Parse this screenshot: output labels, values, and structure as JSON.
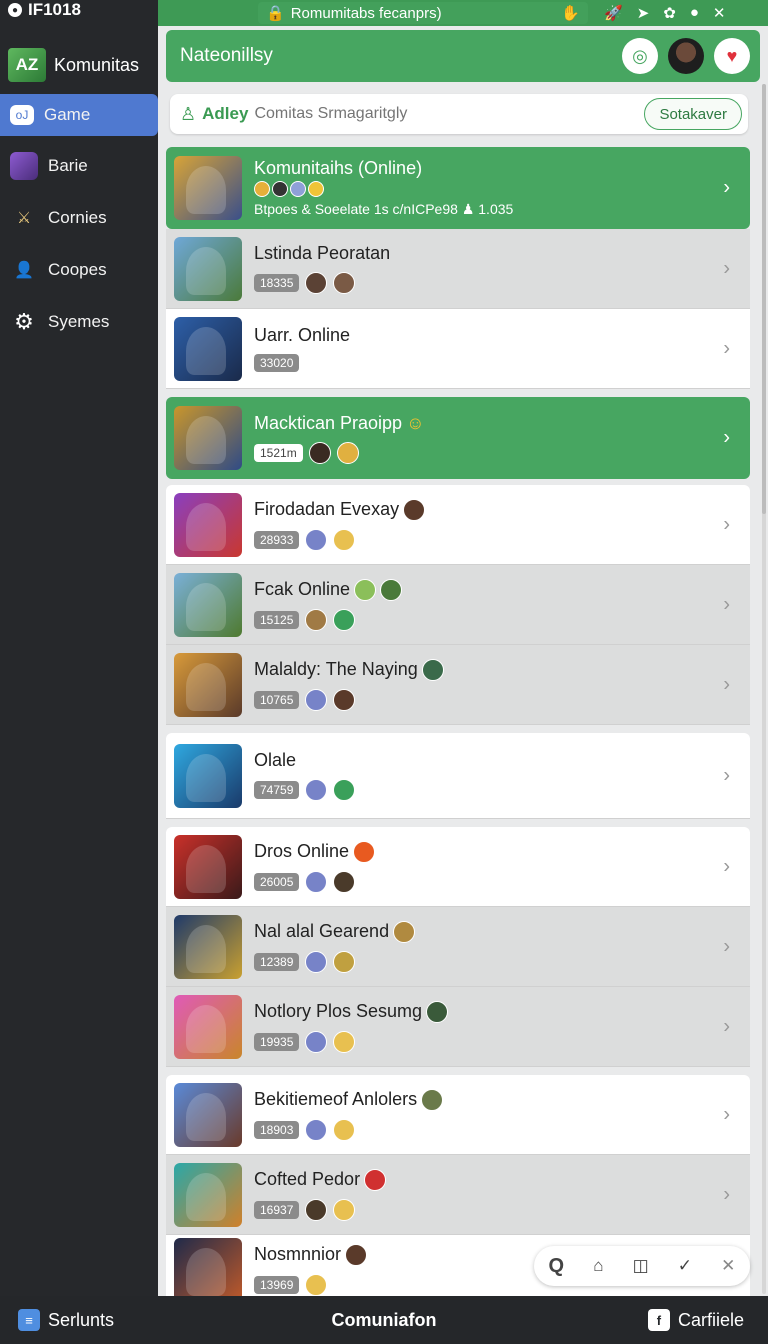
{
  "status": {
    "time": "IF1018"
  },
  "sidebar": {
    "brand_logo": "AZ",
    "brand_name": "Komunitas",
    "items": [
      {
        "label": "Game",
        "icon": "gamepad-icon",
        "active": true
      },
      {
        "label": "Barie",
        "icon": "character-icon"
      },
      {
        "label": "Cornies",
        "icon": "swords-icon"
      },
      {
        "label": "Coopes",
        "icon": "user-icon"
      },
      {
        "label": "Syemes",
        "icon": "gear-icon"
      }
    ]
  },
  "browser": {
    "url": "Romumitabs fecanprs)"
  },
  "header": {
    "title": "Nateonillsy"
  },
  "search": {
    "label": "Adley",
    "placeholder": "Comitas Srmagaritgly",
    "button": "Sotakaver"
  },
  "featured": {
    "title": "Komunitaihs (Online)",
    "subtitle": "Btpoes & Soeelate 1s c/nICPe98",
    "count": "1.035"
  },
  "games": [
    {
      "title": "Lstinda Peoratan",
      "badge": "18335",
      "style": "grey"
    },
    {
      "title": "Uarr. Online",
      "badge": "33020",
      "style": "white"
    },
    {
      "title": "Macktican Praoipp",
      "badge": "1521m",
      "style": "green"
    },
    {
      "title": "Firodadan Evexay",
      "badge": "28933",
      "style": "white"
    },
    {
      "title": "Fcak Online",
      "badge": "15125",
      "style": "grey"
    },
    {
      "title": "Malaldy: The Naying",
      "badge": "10765",
      "style": "grey"
    },
    {
      "title": "Olale",
      "badge": "74759",
      "style": "white"
    },
    {
      "title": "Dros Online",
      "badge": "26005",
      "style": "white"
    },
    {
      "title": "Nal alal Gearend",
      "badge": "12389",
      "style": "grey"
    },
    {
      "title": "Notlory Plos Sesumg",
      "badge": "19935",
      "style": "grey"
    },
    {
      "title": "Bekitiemeof Anlolers",
      "badge": "18903",
      "style": "white"
    },
    {
      "title": "Cofted Pedor",
      "badge": "16937",
      "style": "grey"
    },
    {
      "title": "Nosmnnior",
      "badge": "13969",
      "style": "white"
    }
  ],
  "bottom": {
    "left": "Serlunts",
    "center": "Comuniafon",
    "right": "Carfiiele"
  },
  "colors": {
    "accent": "#47a661",
    "sidebar": "#26282b",
    "active": "#4f79d0"
  }
}
